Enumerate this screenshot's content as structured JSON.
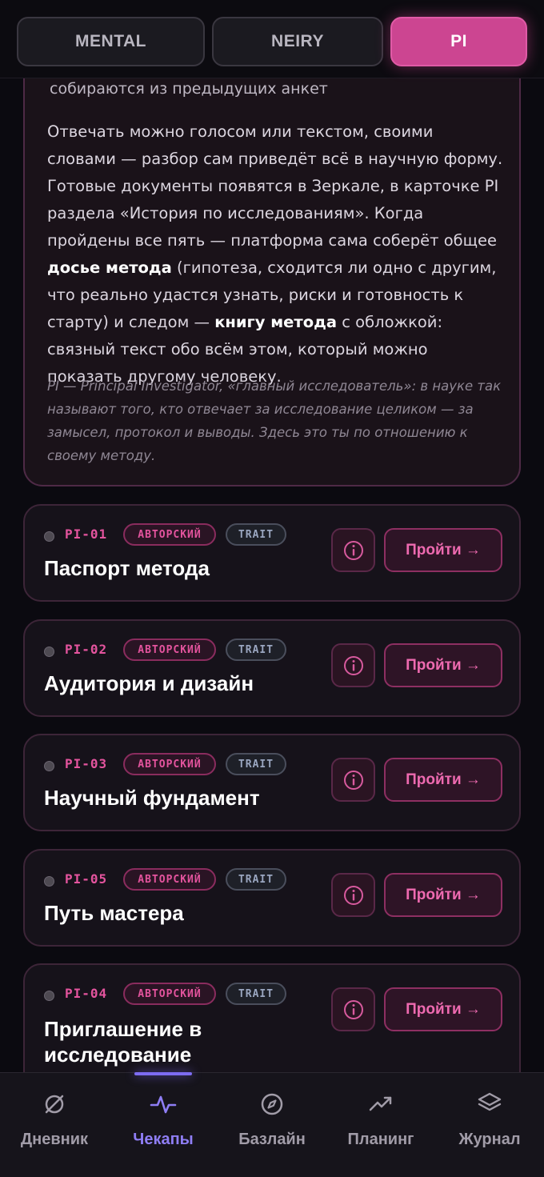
{
  "tabs": [
    {
      "label": "MENTAL",
      "active": false
    },
    {
      "label": "NEIRY",
      "active": false
    },
    {
      "label": "PI",
      "active": true
    }
  ],
  "intro": {
    "line1": "собираются из предыдущих анкет",
    "p_part1": "Отвечать можно голосом или текстом, своими словами — разбор сам приведёт всё в научную форму. Готовые документы появятся в Зеркале, в карточке PI раздела «История по исследованиям». Когда пройдены все пять — платформа сама соберёт общее ",
    "p_bold1": "досье метода",
    "p_part2": " (гипотеза, сходится ли одно с другим, что реально удастся узнать, риски и готовность к старту) и следом — ",
    "p_bold2": "книгу метода",
    "p_part3": " с обложкой: связный текст обо всём этом, который можно показать другому человеку.",
    "note": "PI — Principal Investigator, «главный исследователь»: в науке так называют того, кто отвечает за исследование целиком — за замысел, протокол и выводы. Здесь это ты по отношению к своему методу."
  },
  "cards": [
    {
      "code": "PI-01",
      "badge_author": "АВТОРСКИЙ",
      "badge_trait": "TRAIT",
      "title": "Паспорт метода",
      "action": "Пройти →"
    },
    {
      "code": "PI-02",
      "badge_author": "АВТОРСКИЙ",
      "badge_trait": "TRAIT",
      "title": "Аудитория и дизайн",
      "action": "Пройти →"
    },
    {
      "code": "PI-03",
      "badge_author": "АВТОРСКИЙ",
      "badge_trait": "TRAIT",
      "title": "Научный фундамент",
      "action": "Пройти →"
    },
    {
      "code": "PI-05",
      "badge_author": "АВТОРСКИЙ",
      "badge_trait": "TRAIT",
      "title": "Путь мастера",
      "action": "Пройти →"
    },
    {
      "code": "PI-04",
      "badge_author": "АВТОРСКИЙ",
      "badge_trait": "TRAIT",
      "title": "Приглашение в исследование",
      "action": "Пройти →"
    }
  ],
  "nav": [
    {
      "label": "Дневник",
      "icon": "circle-slash-icon",
      "active": false
    },
    {
      "label": "Чекапы",
      "icon": "pulse-icon",
      "active": true
    },
    {
      "label": "Базлайн",
      "icon": "compass-icon",
      "active": false
    },
    {
      "label": "Планинг",
      "icon": "trend-up-icon",
      "active": false
    },
    {
      "label": "Журнал",
      "icon": "layers-icon",
      "active": false
    }
  ],
  "colors": {
    "accent_pink": "#cc4591",
    "accent_violet": "#8f7ef5",
    "background": "#0b0a10"
  }
}
